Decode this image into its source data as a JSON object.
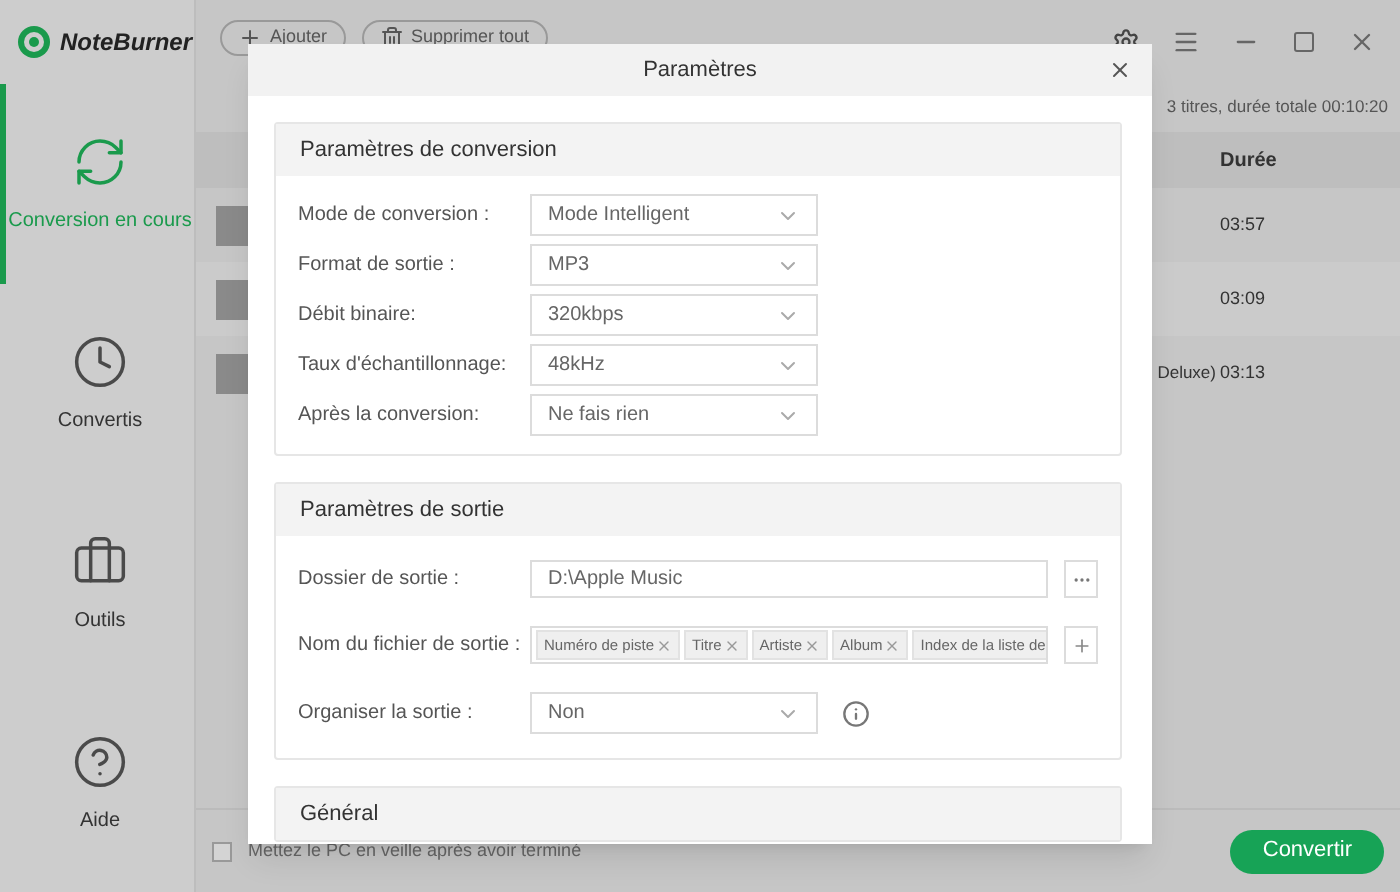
{
  "app": {
    "name": "NoteBurner"
  },
  "toolbar": {
    "buttons": [
      {
        "label": "Ajouter",
        "kind": "add"
      },
      {
        "label": "Supprimer tout",
        "kind": "delete"
      }
    ]
  },
  "sidebar": {
    "items": [
      {
        "label": "Conversion en cours",
        "kind": "convert",
        "selected": true
      },
      {
        "label": "Convertis",
        "kind": "history",
        "selected": false
      },
      {
        "label": "Outils",
        "kind": "tools",
        "selected": false
      },
      {
        "label": "Aide",
        "kind": "help",
        "selected": false
      }
    ]
  },
  "summary": "3 titres, durée totale 00:10:20",
  "table": {
    "columns": [
      "Durée"
    ],
    "rows": [
      {
        "duration": "03:57"
      },
      {
        "duration": "03:09"
      },
      {
        "title": "Deluxe)",
        "duration": "03:13"
      }
    ]
  },
  "footer": {
    "sleep_checkbox": {
      "label": "Mettez le PC en veille après avoir terminé",
      "checked": false
    },
    "convert_button": "Convertir"
  },
  "dialog": {
    "title": "Paramètres",
    "sections": [
      {
        "title": "Paramètres de conversion",
        "fields": [
          {
            "label": "Mode de conversion :",
            "kind": "select",
            "value": "Mode Intelligent"
          },
          {
            "label": "Format de sortie :",
            "kind": "select",
            "value": "MP3"
          },
          {
            "label": "Débit binaire:",
            "kind": "select",
            "value": "320kbps"
          },
          {
            "label": "Taux d'échantillonnage:",
            "kind": "select",
            "value": "48kHz"
          },
          {
            "label": "Après la conversion:",
            "kind": "select",
            "value": "Ne fais rien"
          }
        ]
      },
      {
        "title": "Paramètres de sortie",
        "fields": [
          {
            "label": "Dossier de sortie :",
            "kind": "path",
            "value": "D:\\Apple Music"
          },
          {
            "label": "Nom du fichier de sortie :",
            "kind": "tags",
            "tags": [
              "Numéro de piste",
              "Titre",
              "Artiste",
              "Album",
              "Index de la liste de"
            ]
          },
          {
            "label": "Organiser la sortie :",
            "kind": "select",
            "value": "Non",
            "info": true
          }
        ]
      },
      {
        "title": "Général"
      }
    ]
  }
}
